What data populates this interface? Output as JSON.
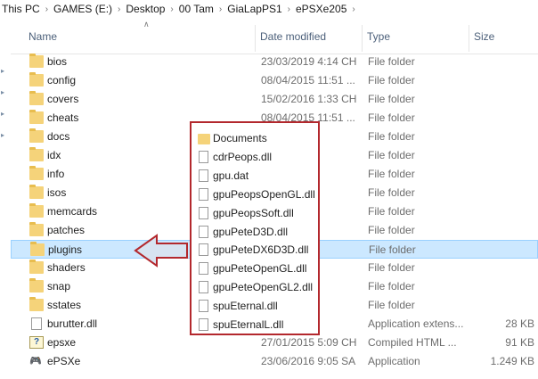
{
  "breadcrumb": [
    "This PC",
    "GAMES (E:)",
    "Desktop",
    "00 Tam",
    "GiaLapPS1",
    "ePSXe205"
  ],
  "columns": {
    "name": "Name",
    "date": "Date modified",
    "type": "Type",
    "size": "Size"
  },
  "rows": [
    {
      "name": "bios",
      "date": "23/03/2019 4:14 CH",
      "type": "File folder",
      "size": "",
      "icon": "folder-icon"
    },
    {
      "name": "config",
      "date": "08/04/2015 11:51 ...",
      "type": "File folder",
      "size": "",
      "icon": "folder-icon"
    },
    {
      "name": "covers",
      "date": "15/02/2016 1:33 CH",
      "type": "File folder",
      "size": "",
      "icon": "folder-icon"
    },
    {
      "name": "cheats",
      "date": "08/04/2015 11:51 ...",
      "type": "File folder",
      "size": "",
      "icon": "folder-icon"
    },
    {
      "name": "docs",
      "date": "...1 SA",
      "type": "File folder",
      "size": "",
      "icon": "folder-icon"
    },
    {
      "name": "idx",
      "date": "...3 CH",
      "type": "File folder",
      "size": "",
      "icon": "folder-icon"
    },
    {
      "name": "info",
      "date": "...3 CH",
      "type": "File folder",
      "size": "",
      "icon": "folder-icon"
    },
    {
      "name": "isos",
      "date": "...51 ...",
      "type": "File folder",
      "size": "",
      "icon": "folder-icon"
    },
    {
      "name": "memcards",
      "date": "...51 ...",
      "type": "File folder",
      "size": "",
      "icon": "folder-icon"
    },
    {
      "name": "patches",
      "date": "...51 ...",
      "type": "File folder",
      "size": "",
      "icon": "folder-icon"
    },
    {
      "name": "plugins",
      "date": "...2 CH",
      "type": "File folder",
      "size": "",
      "icon": "folder-icon",
      "selected": true
    },
    {
      "name": "shaders",
      "date": "...51 ...",
      "type": "File folder",
      "size": "",
      "icon": "folder-icon"
    },
    {
      "name": "snap",
      "date": "...51 ...",
      "type": "File folder",
      "size": "",
      "icon": "folder-icon"
    },
    {
      "name": "sstates",
      "date": "...51 ...",
      "type": "File folder",
      "size": "",
      "icon": "folder-icon"
    },
    {
      "name": "burutter.dll",
      "date": "...9 CH",
      "type": "Application extens...",
      "size": "28 KB",
      "icon": "dll-file-icon"
    },
    {
      "name": "epsxe",
      "date": "27/01/2015 5:09 CH",
      "type": "Compiled HTML ...",
      "size": "91 KB",
      "icon": "help-file-icon"
    },
    {
      "name": "ePSXe",
      "date": "23/06/2016 9:05 SA",
      "type": "Application",
      "size": "1.249 KB",
      "icon": "gamepad-icon"
    }
  ],
  "popup": {
    "items": [
      {
        "label": "Documents",
        "icon": "folder-icon"
      },
      {
        "label": "cdrPeops.dll",
        "icon": "dll-file-icon"
      },
      {
        "label": "gpu.dat",
        "icon": "file-icon"
      },
      {
        "label": "gpuPeopsOpenGL.dll",
        "icon": "dll-file-icon"
      },
      {
        "label": "gpuPeopsSoft.dll",
        "icon": "dll-file-icon"
      },
      {
        "label": "gpuPeteD3D.dll",
        "icon": "dll-file-icon"
      },
      {
        "label": "gpuPeteDX6D3D.dll",
        "icon": "dll-file-icon"
      },
      {
        "label": "gpuPeteOpenGL.dll",
        "icon": "dll-file-icon"
      },
      {
        "label": "gpuPeteOpenGL2.dll",
        "icon": "dll-file-icon"
      },
      {
        "label": "spuEternal.dll",
        "icon": "dll-file-icon"
      },
      {
        "label": "spuEternalL.dll",
        "icon": "dll-file-icon"
      }
    ]
  },
  "colors": {
    "selection": "#cce8ff",
    "selection_border": "#99d1ff",
    "callout_border": "#b3282d",
    "arrow_fill": "#d7e3f1",
    "folder": "#f5d37a"
  }
}
